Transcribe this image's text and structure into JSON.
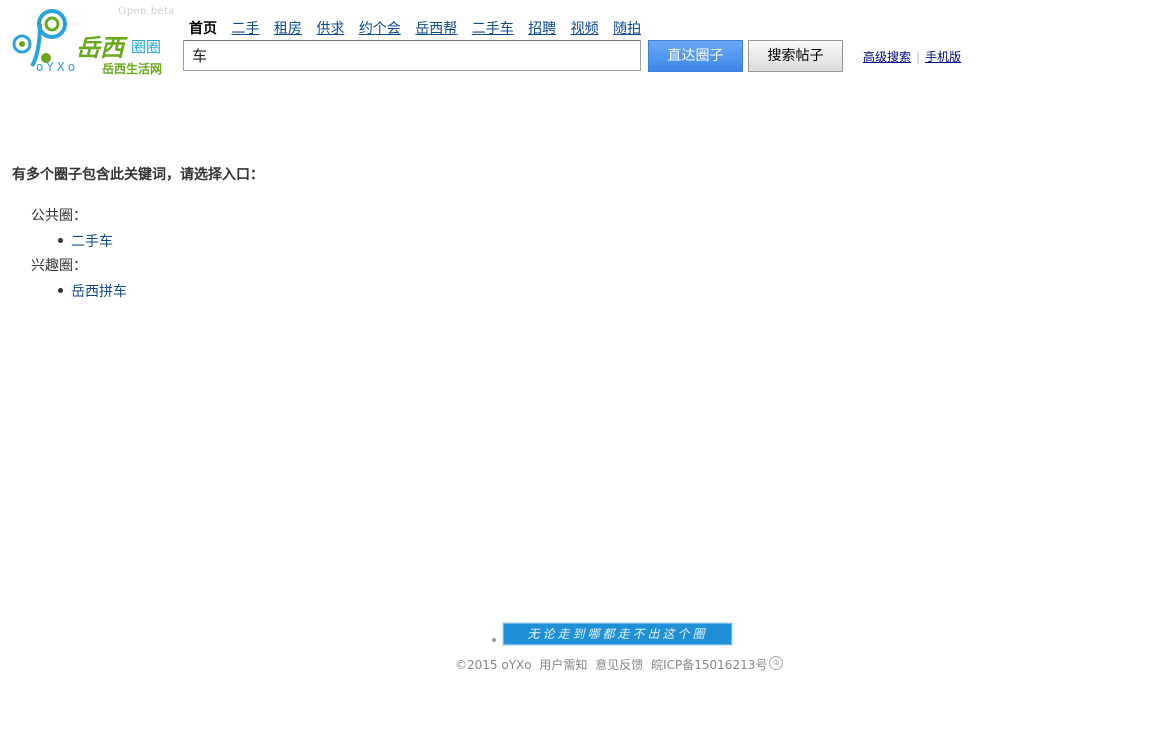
{
  "logo": {
    "beta": "Open beta",
    "brand": "岳西",
    "circle_word": "圈圈",
    "letters": "oYXo",
    "subtitle": "岳西生活网"
  },
  "nav": {
    "items": [
      "首页",
      "二手",
      "租房",
      "供求",
      "约个会",
      "岳西帮",
      "二手车",
      "招聘",
      "视频",
      "随拍"
    ]
  },
  "search": {
    "value": "车",
    "direct_button": "直达圈子",
    "posts_button": "搜索帖子",
    "advanced_link": "高级搜索",
    "separator": "|",
    "mobile_link": "手机版"
  },
  "content": {
    "prompt": "有多个圈子包含此关键词，请选择入口：",
    "groups": [
      {
        "label": "公共圈：",
        "items": [
          "二手车"
        ]
      },
      {
        "label": "兴趣圈：",
        "items": [
          "岳西拼车"
        ]
      }
    ]
  },
  "footer": {
    "banner": "无论走到哪都走不出这个圈",
    "copyright": "©2015  oYXo",
    "terms": "用户需知",
    "feedback": "意见反馈",
    "icp": "皖ICP备15016213号",
    "badge_icon": "police-badge-icon"
  }
}
